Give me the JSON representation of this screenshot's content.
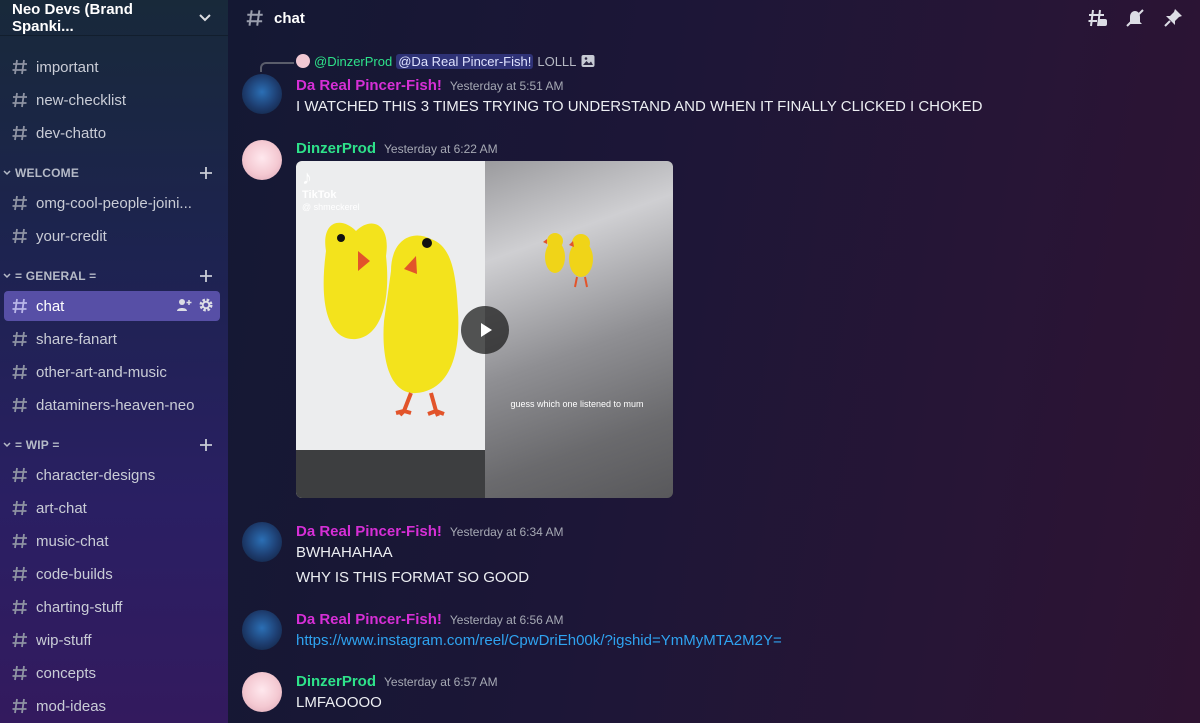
{
  "server": {
    "name": "Neo Devs (Brand Spanki..."
  },
  "channels_top": [
    {
      "name": "important"
    },
    {
      "name": "new-checklist"
    },
    {
      "name": "dev-chatto"
    }
  ],
  "categories": [
    {
      "label": "WELCOME",
      "channels": [
        {
          "name": "omg-cool-people-joini..."
        },
        {
          "name": "your-credit"
        }
      ]
    },
    {
      "label": "= GENERAL =",
      "channels": [
        {
          "name": "chat",
          "active": true
        },
        {
          "name": "share-fanart"
        },
        {
          "name": "other-art-and-music"
        },
        {
          "name": "dataminers-heaven-neo"
        }
      ]
    },
    {
      "label": "= WIP =",
      "channels": [
        {
          "name": "character-designs"
        },
        {
          "name": "art-chat"
        },
        {
          "name": "music-chat"
        },
        {
          "name": "code-builds"
        },
        {
          "name": "charting-stuff"
        },
        {
          "name": "wip-stuff"
        },
        {
          "name": "concepts"
        },
        {
          "name": "mod-ideas"
        }
      ]
    }
  ],
  "header": {
    "channel": "chat"
  },
  "reply": {
    "author": "@DinzerProd",
    "mention": "@Da Real Pincer-Fish!",
    "text": "LOLLL"
  },
  "messages": [
    {
      "author": "Da Real Pincer-Fish!",
      "time": "Yesterday at 5:51 AM",
      "lines": [
        "I WATCHED THIS 3 TIMES TRYING TO UNDERSTAND AND WHEN IT FINALLY CLICKED I CHOKED"
      ]
    },
    {
      "author": "DinzerProd",
      "time": "Yesterday at 6:22 AM",
      "video": {
        "brand": "TikTok",
        "handle": "@ shmeckerel",
        "caption": "guess which one listened to mum"
      }
    },
    {
      "author": "Da Real Pincer-Fish!",
      "time": "Yesterday at 6:34 AM",
      "lines": [
        "BWHAHAHAA",
        "WHY IS THIS FORMAT SO GOOD"
      ]
    },
    {
      "author": "Da Real Pincer-Fish!",
      "time": "Yesterday at 6:56 AM",
      "link": "https://www.instagram.com/reel/CpwDriEh00k/?igshid=YmMyMTA2M2Y="
    },
    {
      "author": "DinzerProd",
      "time": "Yesterday at 6:57 AM",
      "lines": [
        "LMFAOOOO"
      ]
    }
  ],
  "colors": {
    "fish_name": "#d62fd6",
    "dinzer_name": "#2ee28a",
    "link": "#2fa3f0",
    "active_channel": "#574fa6"
  },
  "icons": [
    "chevron-down-icon",
    "hash-icon",
    "plus-icon",
    "add-member-icon",
    "gear-icon",
    "threads-icon",
    "mute-icon",
    "pin-icon",
    "image-icon",
    "play-icon"
  ]
}
